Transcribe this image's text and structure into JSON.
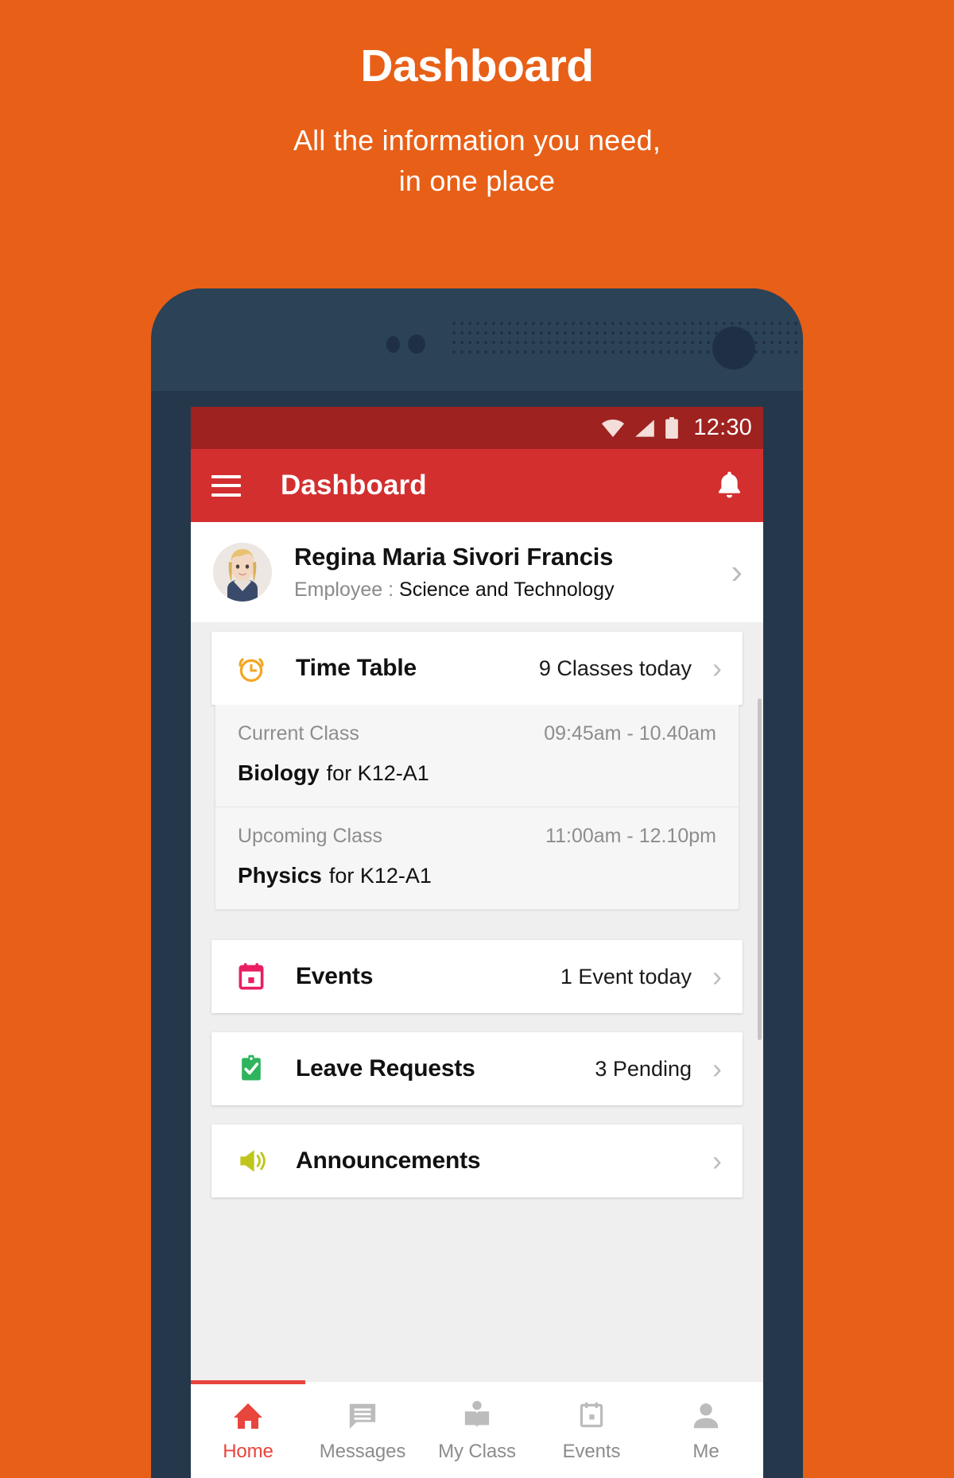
{
  "promo": {
    "title": "Dashboard",
    "subtitle_line1": "All the information you need,",
    "subtitle_line2": "in one place"
  },
  "colors": {
    "background": "#E85F17",
    "device": "#25384b",
    "statusbar": "#9e2220",
    "appbar": "#d32f2f",
    "accent": "#e8453c",
    "timetable_icon": "#F5A623",
    "events_icon": "#E91E63",
    "leave_icon": "#2EB45C",
    "announcements_icon": "#BFC51B"
  },
  "statusbar": {
    "time": "12:30",
    "icons": [
      "wifi-icon",
      "signal-icon",
      "battery-icon"
    ]
  },
  "appbar": {
    "menu_icon": "hamburger-menu-icon",
    "title": "Dashboard",
    "notification_icon": "bell-icon"
  },
  "profile": {
    "avatar": "user-avatar",
    "name": "Regina Maria Sivori Francis",
    "role_label": "Employee :",
    "role_value": "Science and Technology",
    "chevron": "chevron-right-icon"
  },
  "cards": {
    "time_table": {
      "icon": "alarm-clock-icon",
      "label": "Time Table",
      "meta": "9 Classes today"
    },
    "current_class": {
      "heading": "Current Class",
      "time": "09:45am - 10.40am",
      "subject": "Biology",
      "for": "for K12-A1"
    },
    "upcoming_class": {
      "heading": "Upcoming Class",
      "time": "11:00am - 12.10pm",
      "subject": "Physics",
      "for": "for K12-A1"
    },
    "events": {
      "icon": "calendar-icon",
      "label": "Events",
      "meta": "1 Event today"
    },
    "leave_requests": {
      "icon": "clipboard-check-icon",
      "label": "Leave Requests",
      "meta": "3 Pending"
    },
    "announcements": {
      "icon": "megaphone-icon",
      "label": "Announcements",
      "meta": ""
    }
  },
  "bottom_nav": {
    "items": [
      {
        "label": "Home",
        "icon": "home-icon",
        "active": true
      },
      {
        "label": "Messages",
        "icon": "message-icon",
        "active": false
      },
      {
        "label": "My Class",
        "icon": "book-icon",
        "active": false
      },
      {
        "label": "Events",
        "icon": "calendar-icon",
        "active": false
      },
      {
        "label": "Me",
        "icon": "person-icon",
        "active": false
      }
    ]
  }
}
